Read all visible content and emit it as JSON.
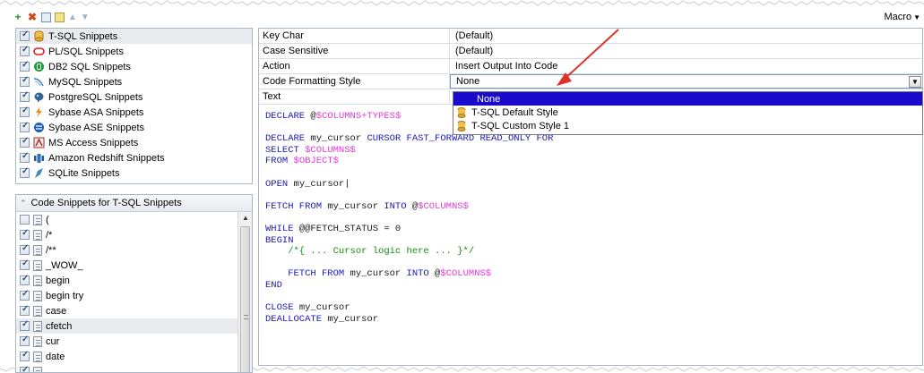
{
  "toolbar": {
    "macro_label": "Macro",
    "icons": [
      "add-icon",
      "delete-icon",
      "properties-icon",
      "copy-icon",
      "move-up-icon",
      "move-down-icon"
    ]
  },
  "snippet_groups": [
    {
      "label": "T-SQL Snippets",
      "checked": true,
      "icon": "tsql-db-icon",
      "selected": true
    },
    {
      "label": "PL/SQL Snippets",
      "checked": true,
      "icon": "oracle-icon"
    },
    {
      "label": "DB2 SQL Snippets",
      "checked": true,
      "icon": "db2-icon"
    },
    {
      "label": "MySQL Snippets",
      "checked": true,
      "icon": "mysql-icon"
    },
    {
      "label": "PostgreSQL Snippets",
      "checked": true,
      "icon": "postgresql-icon"
    },
    {
      "label": "Sybase ASA Snippets",
      "checked": true,
      "icon": "sybase-asa-icon"
    },
    {
      "label": "Sybase ASE Snippets",
      "checked": true,
      "icon": "sybase-ase-icon"
    },
    {
      "label": "MS Access Snippets",
      "checked": true,
      "icon": "ms-access-icon"
    },
    {
      "label": "Amazon Redshift Snippets",
      "checked": true,
      "icon": "redshift-icon"
    },
    {
      "label": "SQLite Snippets",
      "checked": true,
      "icon": "sqlite-icon"
    }
  ],
  "code_snippets": {
    "header": "Code Snippets for T-SQL Snippets",
    "items": [
      {
        "label": "(",
        "checked": false
      },
      {
        "label": "/*",
        "checked": true
      },
      {
        "label": "/**",
        "checked": true
      },
      {
        "label": "_WOW_",
        "checked": true
      },
      {
        "label": "begin",
        "checked": true
      },
      {
        "label": "begin try",
        "checked": true
      },
      {
        "label": "case",
        "checked": true
      },
      {
        "label": "cfetch",
        "checked": true,
        "selected": true
      },
      {
        "label": "cur",
        "checked": true
      },
      {
        "label": "date",
        "checked": true
      },
      {
        "label": "",
        "checked": true
      }
    ]
  },
  "properties": [
    {
      "name": "Key Char",
      "value": "(Default)"
    },
    {
      "name": "Case Sensitive",
      "value": "(Default)"
    },
    {
      "name": "Action",
      "value": "Insert Output Into Code"
    },
    {
      "name": "Code Formatting Style",
      "value": "None"
    },
    {
      "name": "Text",
      "value": ""
    }
  ],
  "style_dropdown": {
    "options": [
      {
        "label": "None",
        "selected": true
      },
      {
        "label": "T-SQL Default Style"
      },
      {
        "label": "T-SQL Custom Style 1"
      }
    ]
  },
  "colors": {
    "keyword": "#1a18b8",
    "token": "#e23ad6",
    "comment": "#138f13",
    "selection": "#1a0acd",
    "arrow": "#e0302a"
  },
  "code_lines": [
    [
      {
        "t": "DECLARE ",
        "c": "kw"
      },
      {
        "t": "@",
        "c": "plain"
      },
      {
        "t": "$COLUMNS+TYPES$",
        "c": "tok"
      }
    ],
    [],
    [
      {
        "t": "DECLARE ",
        "c": "kw"
      },
      {
        "t": "my_cursor ",
        "c": "plain"
      },
      {
        "t": "CURSOR FAST_FORWARD READ_ONLY FOR",
        "c": "kw"
      }
    ],
    [
      {
        "t": "SELECT ",
        "c": "kw"
      },
      {
        "t": "$COLUMNS$",
        "c": "tok"
      }
    ],
    [
      {
        "t": "FROM ",
        "c": "kw"
      },
      {
        "t": "$OBJECT$",
        "c": "tok"
      }
    ],
    [],
    [
      {
        "t": "OPEN ",
        "c": "kw"
      },
      {
        "t": "my_cursor|",
        "c": "plain"
      }
    ],
    [],
    [
      {
        "t": "FETCH FROM ",
        "c": "kw"
      },
      {
        "t": "my_cursor ",
        "c": "plain"
      },
      {
        "t": "INTO ",
        "c": "kw"
      },
      {
        "t": "@",
        "c": "plain"
      },
      {
        "t": "$COLUMNS$",
        "c": "tok"
      }
    ],
    [],
    [
      {
        "t": "WHILE ",
        "c": "kw"
      },
      {
        "t": "@@FETCH_STATUS = 0",
        "c": "plain"
      }
    ],
    [
      {
        "t": "BEGIN",
        "c": "kw"
      }
    ],
    [
      {
        "t": "    /*{ ... Cursor logic here ... }*/",
        "c": "cmt"
      }
    ],
    [],
    [
      {
        "t": "    FETCH FROM ",
        "c": "kw"
      },
      {
        "t": "my_cursor ",
        "c": "plain"
      },
      {
        "t": "INTO ",
        "c": "kw"
      },
      {
        "t": "@",
        "c": "plain"
      },
      {
        "t": "$COLUMNS$",
        "c": "tok"
      }
    ],
    [
      {
        "t": "END",
        "c": "kw"
      }
    ],
    [],
    [
      {
        "t": "CLOSE ",
        "c": "kw"
      },
      {
        "t": "my_cursor",
        "c": "plain"
      }
    ],
    [
      {
        "t": "DEALLOCATE ",
        "c": "kw"
      },
      {
        "t": "my_cursor",
        "c": "plain"
      }
    ]
  ]
}
